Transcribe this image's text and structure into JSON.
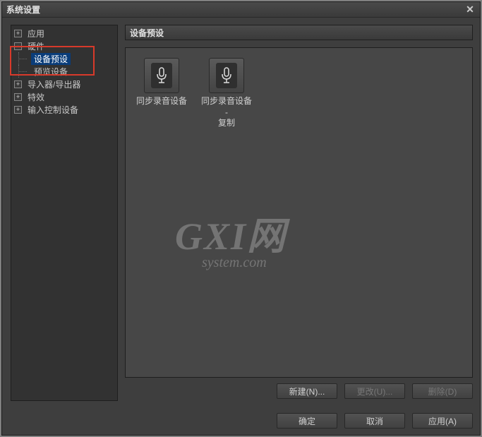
{
  "window": {
    "title": "系统设置"
  },
  "tree": {
    "items": [
      {
        "label": "应用",
        "level": 1,
        "expander": "+"
      },
      {
        "label": "硬件",
        "level": 1,
        "expander": "-"
      },
      {
        "label": "设备预设",
        "level": 2,
        "selected": true
      },
      {
        "label": "预览设备",
        "level": 2
      },
      {
        "label": "导入器/导出器",
        "level": 1,
        "expander": "+"
      },
      {
        "label": "特效",
        "level": 1,
        "expander": "+"
      },
      {
        "label": "输入控制设备",
        "level": 1,
        "expander": "+"
      }
    ]
  },
  "panel": {
    "header": "设备预设"
  },
  "presets": [
    {
      "label": "同步录音设备"
    },
    {
      "label": "同步录音设备 -\n复制"
    }
  ],
  "watermark": {
    "line1": "GXI网",
    "line2": "system.com"
  },
  "panelButtons": {
    "new": "新建(N)...",
    "change": "更改(U)...",
    "delete": "删除(D)"
  },
  "footerButtons": {
    "ok": "确定",
    "cancel": "取消",
    "apply": "应用(A)"
  }
}
